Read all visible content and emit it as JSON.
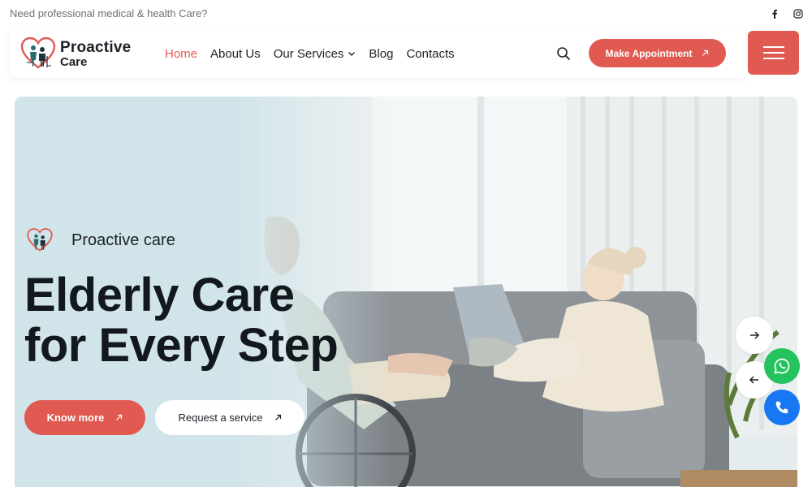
{
  "topbar": {
    "text": "Need professional medical & health Care?",
    "social": [
      {
        "name": "facebook-icon"
      },
      {
        "name": "instagram-icon"
      }
    ]
  },
  "header": {
    "logo": {
      "title": "Proactive",
      "subtitle": "Care"
    },
    "nav": [
      {
        "label": "Home",
        "active": true
      },
      {
        "label": "About Us",
        "active": false
      },
      {
        "label": "Our Services",
        "active": false,
        "has_dropdown": true
      },
      {
        "label": "Blog",
        "active": false
      },
      {
        "label": "Contacts",
        "active": false
      }
    ],
    "appointment_label": "Make Appointment"
  },
  "hero": {
    "tagline": "Proactive care",
    "headline_line1": "Elderly Care",
    "headline_line2": "for Every Step",
    "primary_button": "Know more",
    "secondary_button": "Request a service"
  },
  "colors": {
    "accent": "#e05a52",
    "dark_text": "#1c2127",
    "hero_bg": "#d7e6ea",
    "whatsapp": "#25c35e",
    "phone": "#1877f2"
  },
  "icons": {
    "search": "search-icon",
    "menu": "hamburger-icon",
    "next": "arrow-right-icon",
    "prev": "arrow-left-icon",
    "whatsapp": "whatsapp-icon",
    "phone": "phone-icon"
  }
}
